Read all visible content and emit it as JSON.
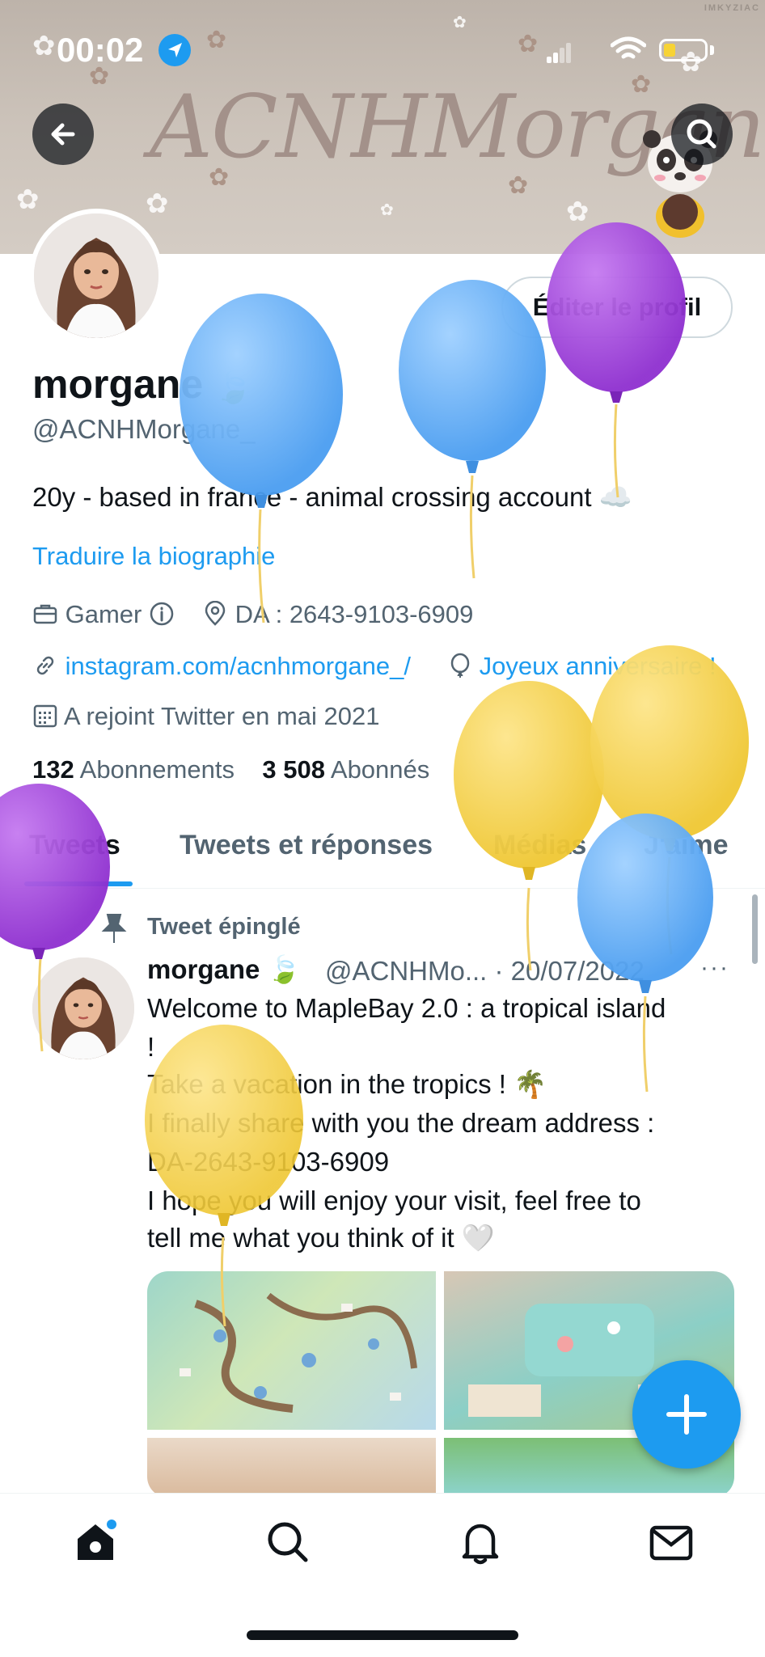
{
  "status_bar": {
    "time": "00:02",
    "watermark": "IMKYZIAC"
  },
  "banner": {
    "title": "ACNHMorgane_"
  },
  "profile": {
    "edit_button": "Éditer le profil",
    "name": "morgane",
    "handle": "@ACNHMorgane_",
    "bio": "20y - based in france - animal crossing account",
    "translate_link": "Traduire la biographie",
    "category": "Gamer",
    "location": "DA : 2643-9103-6909",
    "website": "instagram.com/acnhmorgane_/",
    "birthday": "Joyeux anniversaire !",
    "joined": "A rejoint Twitter en mai 2021",
    "following_count": "132",
    "following_label": "Abonnements",
    "followers_count": "3 508",
    "followers_label": "Abonnés"
  },
  "tabs": [
    {
      "label": "Tweets"
    },
    {
      "label": "Tweets et réponses"
    },
    {
      "label": "Médias"
    },
    {
      "label": "J'aime"
    }
  ],
  "pinned_tweet": {
    "pinned_label": "Tweet épinglé",
    "name": "morgane",
    "handle_date": "@ACNHMo... · 20/07/2022",
    "more": "···",
    "lines": [
      "Welcome to MapleBay 2.0 : a tropical island",
      "!",
      "Take a vacation in the tropics ! 🌴",
      "I finally share with you the dream address :",
      "DA-2643-9103-6909",
      "I hope you will enjoy your visit, feel free to",
      "tell me what you think of it 🤍"
    ]
  },
  "fab": {
    "label": "+"
  },
  "colors": {
    "accent": "#1d9bf0",
    "text": "#0f1419",
    "secondary": "#536471",
    "balloon_blue": "#5aa9f2",
    "balloon_purple": "#9b3fd6",
    "balloon_yellow": "#f3cf45"
  },
  "icons": [
    "back-arrow-icon",
    "search-icon",
    "briefcase-icon",
    "info-icon",
    "location-pin-icon",
    "link-icon",
    "balloon-icon",
    "calendar-icon",
    "pin-icon",
    "leaf-emoji",
    "cloud-emoji",
    "more-icon",
    "compose-plus-icon",
    "home-icon",
    "notifications-bell-icon",
    "messages-envelope-icon"
  ]
}
